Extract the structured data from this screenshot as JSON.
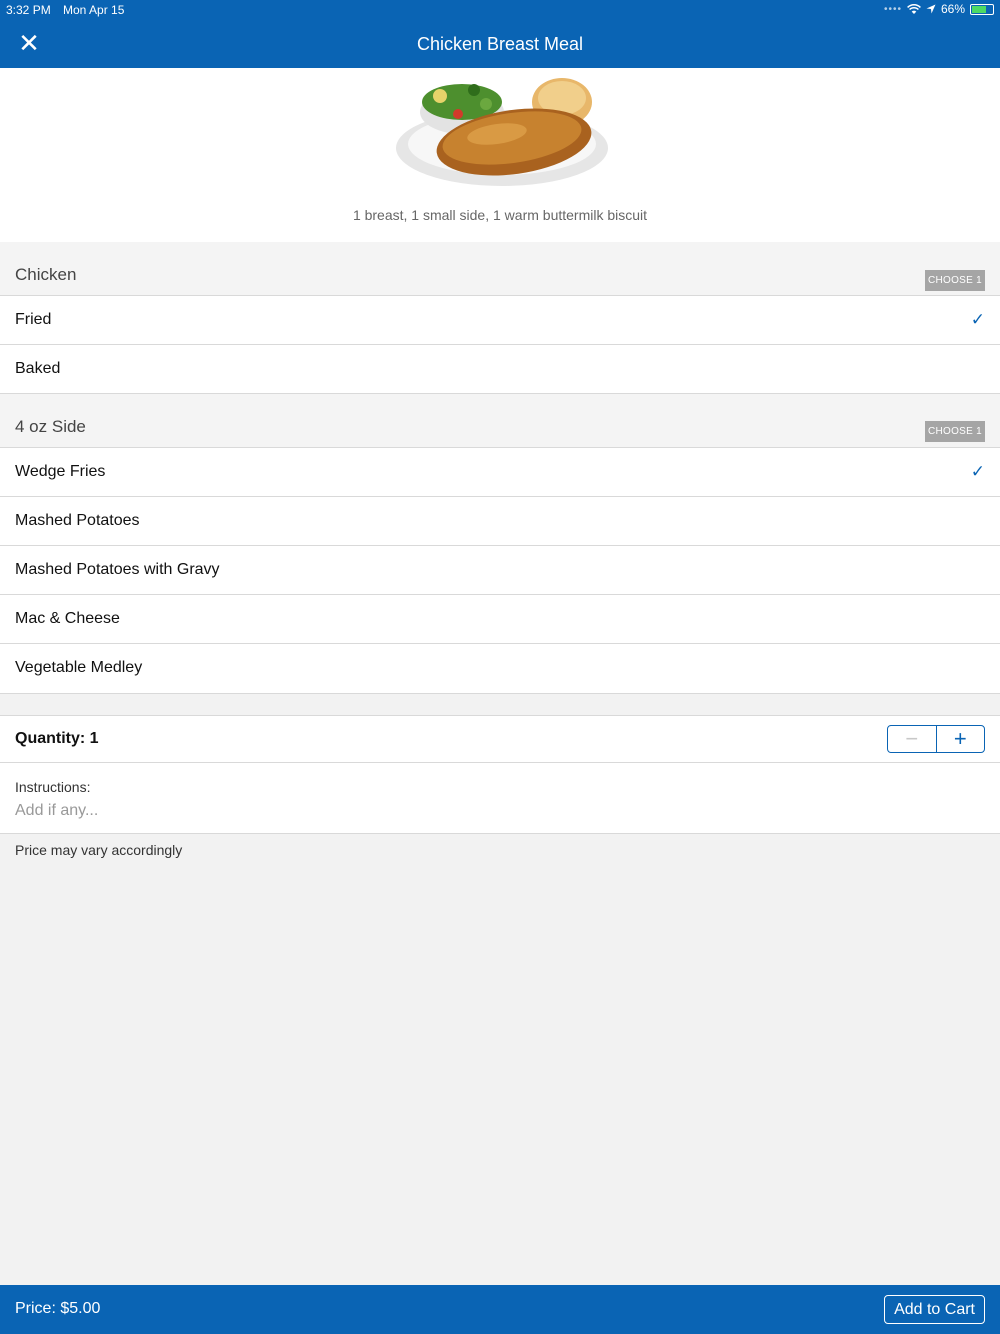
{
  "status": {
    "time": "3:32 PM",
    "date": "Mon Apr 15",
    "battery": "66%"
  },
  "header": {
    "title": "Chicken Breast Meal"
  },
  "item": {
    "description": "1 breast, 1 small side, 1 warm buttermilk biscuit"
  },
  "sections": [
    {
      "title": "Chicken",
      "badge": "CHOOSE 1",
      "options": [
        {
          "label": "Fried",
          "selected": true
        },
        {
          "label": "Baked",
          "selected": false
        }
      ]
    },
    {
      "title": "4 oz Side",
      "badge": "CHOOSE 1",
      "options": [
        {
          "label": "Wedge Fries",
          "selected": true
        },
        {
          "label": "Mashed Potatoes",
          "selected": false
        },
        {
          "label": "Mashed Potatoes with Gravy",
          "selected": false
        },
        {
          "label": "Mac & Cheese",
          "selected": false
        },
        {
          "label": "Vegetable Medley",
          "selected": false
        }
      ]
    }
  ],
  "quantity": {
    "label": "Quantity: 1",
    "value": 1
  },
  "instructions": {
    "label": "Instructions:",
    "value": "",
    "placeholder": "Add if any..."
  },
  "note": "Price may vary accordingly",
  "footer": {
    "price": "Price: $5.00",
    "cart_label": "Add to Cart"
  },
  "icons": {
    "close": "close-icon",
    "check": "checkmark-icon",
    "minus": "minus-icon",
    "plus": "plus-icon"
  },
  "colors": {
    "brand": "#0a64b4",
    "badge": "#a5a5a5",
    "battery": "#4cd964"
  }
}
